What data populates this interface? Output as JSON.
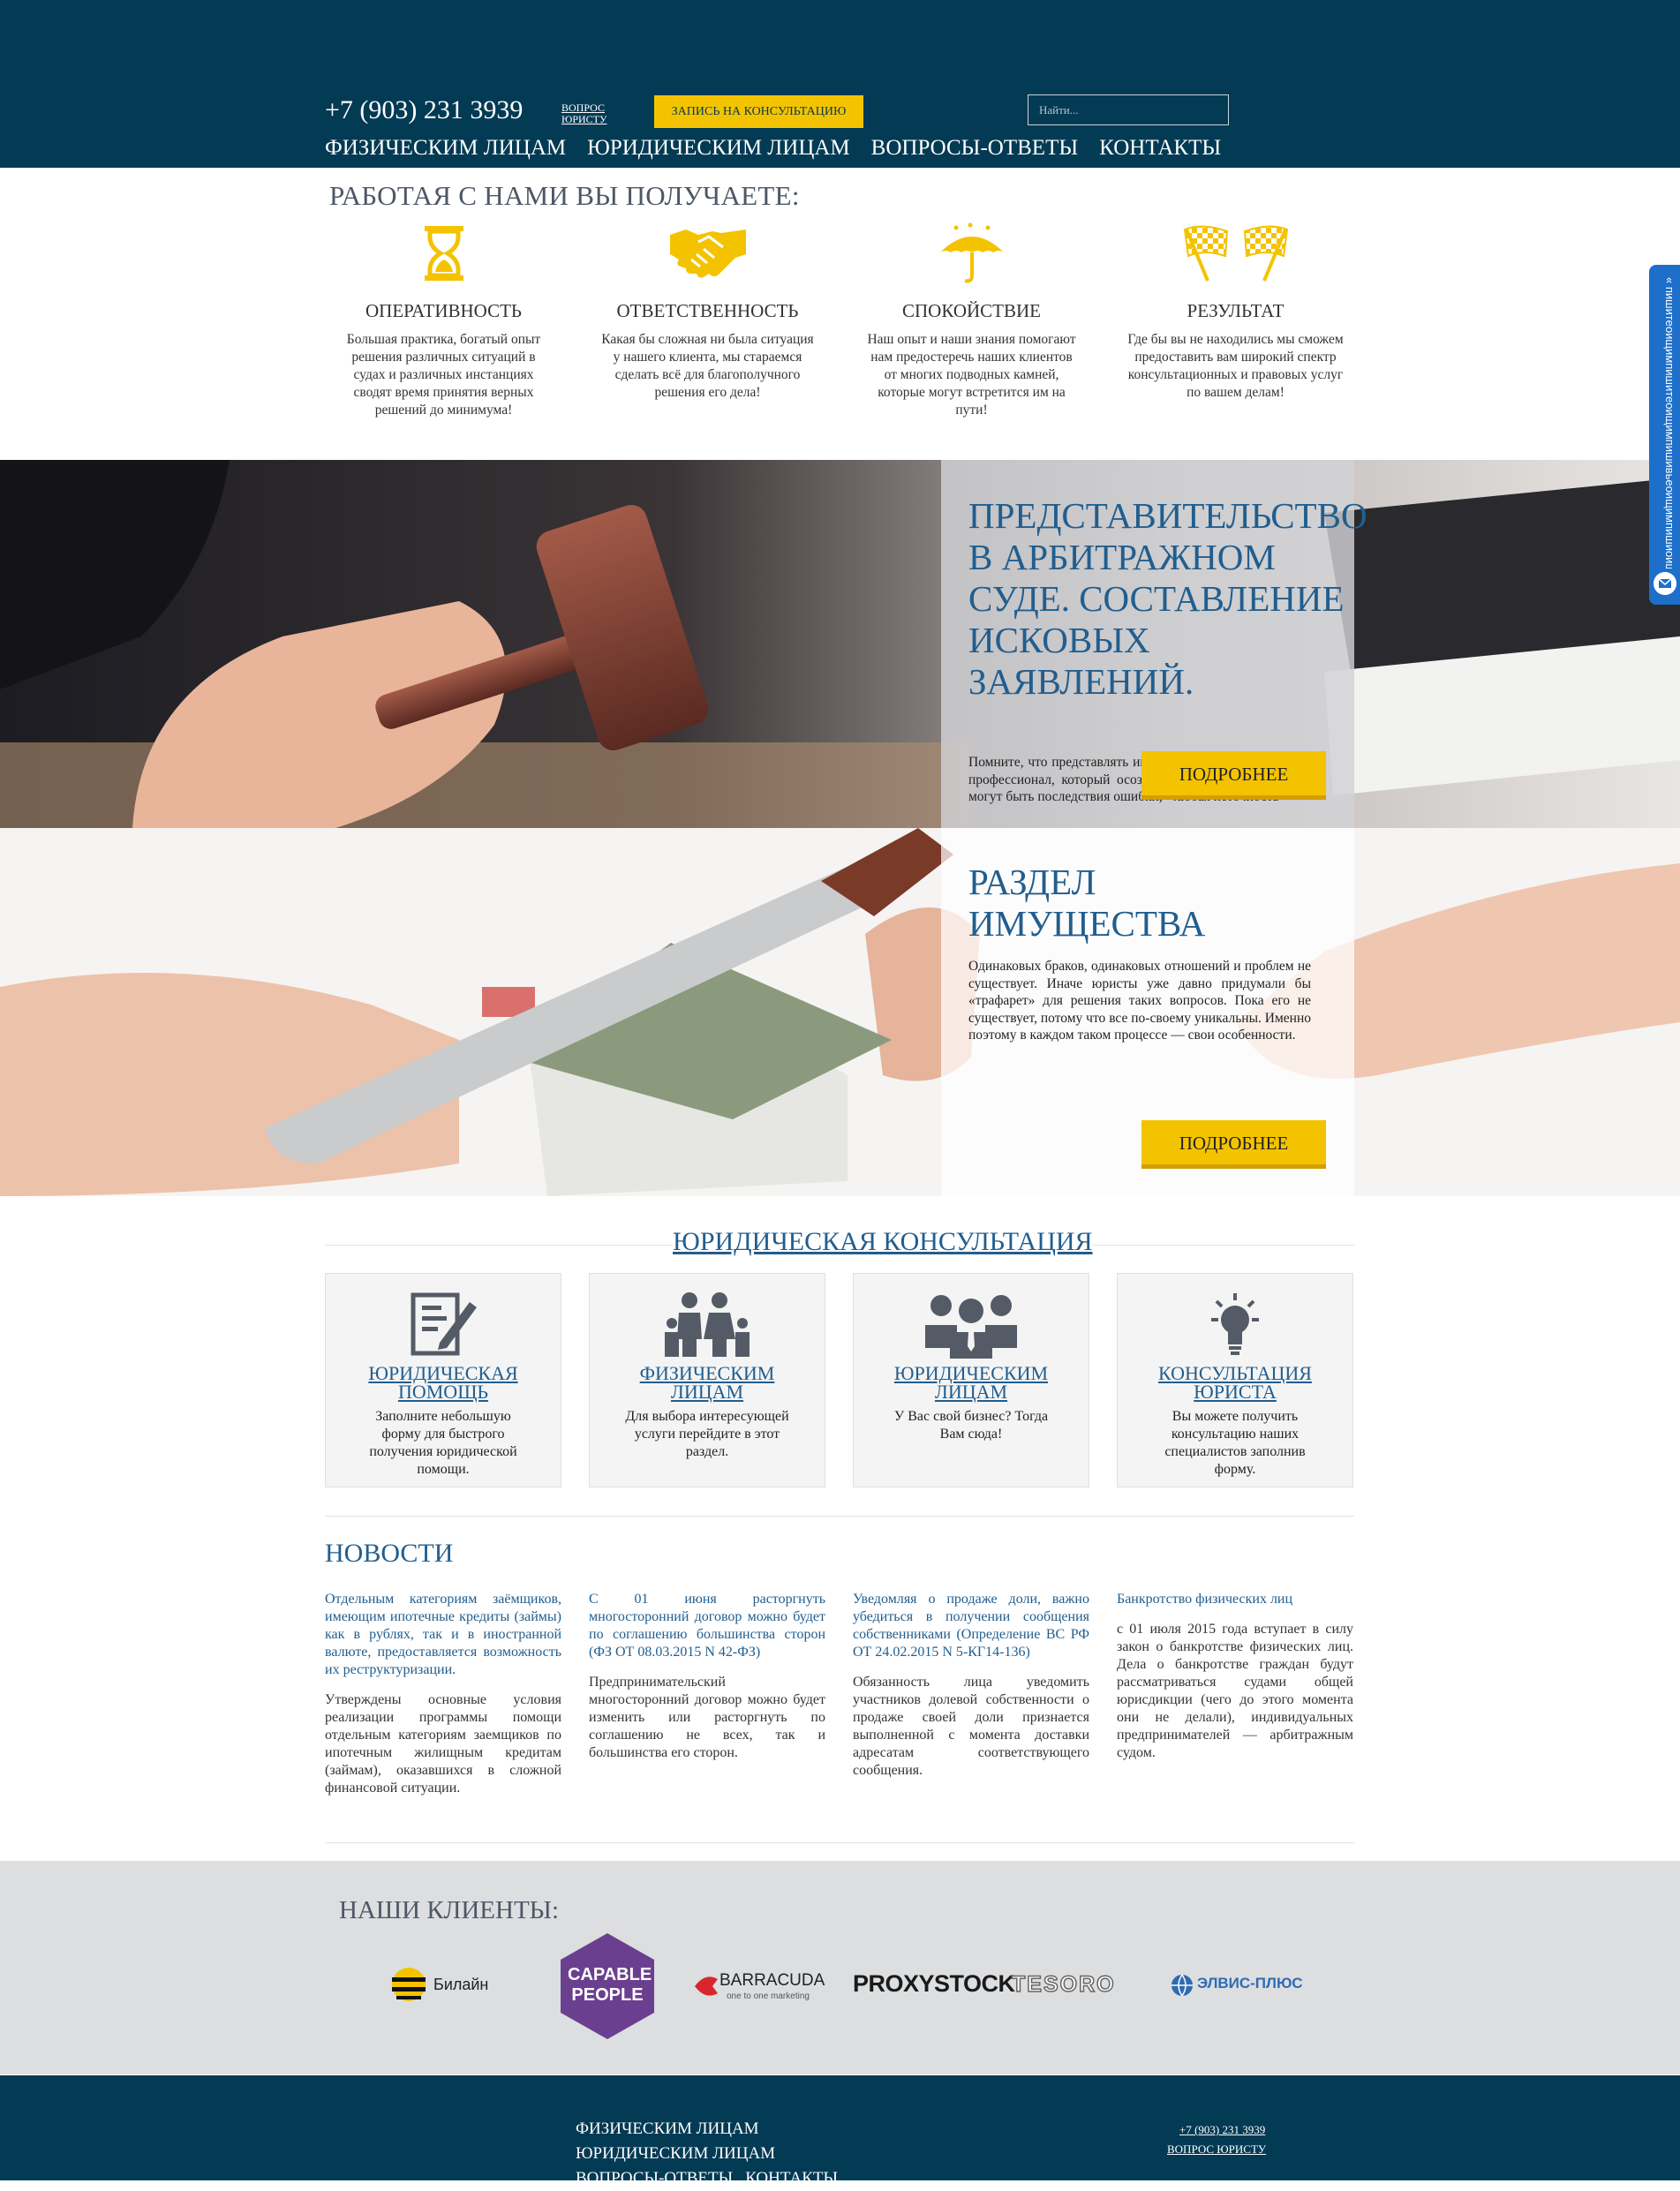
{
  "header": {
    "phone": "+7 (903) 231 3939",
    "ask_lawyer": "ВОПРОС ЮРИСТУ",
    "consult_button": "ЗАПИСЬ НА КОНСУЛЬТАЦИЮ",
    "search_placeholder": "Найти...",
    "nav": [
      "ФИЗИЧЕСКИМ ЛИЦАМ",
      "ЮРИДИЧЕСКИМ ЛИЦАМ",
      "ВОПРОСЫ-ОТВЕТЫ",
      "КОНТАКТЫ"
    ]
  },
  "benefits": {
    "title": "РАБОТАЯ С НАМИ ВЫ ПОЛУЧАЕТЕ:",
    "items": [
      {
        "icon": "hourglass-icon",
        "title": "ОПЕРАТИВНОСТЬ",
        "text": "Большая практика, богатый опыт решения различных ситуаций в судах и различных инстанциях сводят время принятия верных решений до минимума!"
      },
      {
        "icon": "handshake-icon",
        "title": "ОТВЕТСТВЕННОСТЬ",
        "text": "Какая бы сложная ни была ситуация у нашего клиента, мы стараемся сделать всё для благополучного решения его дела!"
      },
      {
        "icon": "umbrella-icon",
        "title": "СПОКОЙСТВИЕ",
        "text": "Наш опыт и наши знания помогают нам предостеречь наших клиентов от многих подводных камней, которые могут встретится им на пути!"
      },
      {
        "icon": "checkered-flags-icon",
        "title": "РЕЗУЛЬТАТ",
        "text": "Где бы вы не находились мы сможем предоставить вам широкий спектр консультационных и правовых услуг по вашем делам!"
      }
    ]
  },
  "banners": [
    {
      "title": "ПРЕДСТАВИТЕЛЬСТВО В АРБИТРАЖНОМ СУДЕ. СОСТАВЛЕНИЕ ИСКОВЫХ ЗАЯВЛЕНИЙ.",
      "text": "Помните, что представлять интересы в суде может только профессионал, который осознает, насколько серьезными могут быть последствия ошибки, - любая неточность",
      "button": "ПОДРОБНЕЕ"
    },
    {
      "title": "РАЗДЕЛ ИМУЩЕСТВА",
      "text": "Одинаковых браков, одинаковых отношений и проблем не существует. Иначе юристы уже давно придумали бы «трафарет» для решения таких вопросов. Пока его не существует, потому что все по-своему уникальны. Именно поэтому в каждом таком процессе — свои особенности.",
      "button": "ПОДРОБНЕЕ"
    }
  ],
  "consultation": {
    "title": "ЮРИДИЧЕСКАЯ КОНСУЛЬТАЦИЯ",
    "cards": [
      {
        "icon": "document-pen-icon",
        "title": "ЮРИДИЧЕСКАЯ ПОМОЩЬ",
        "text": "Заполните небольшую форму для быстрого получения юридической помощи."
      },
      {
        "icon": "family-icon",
        "title": "ФИЗИЧЕСКИМ ЛИЦАМ",
        "text": "Для выбора интересующей услуги перейдите в этот раздел."
      },
      {
        "icon": "business-team-icon",
        "title": "ЮРИДИЧЕСКИМ ЛИЦАМ",
        "text": "У Вас свой бизнес? Тогда Вам сюда!"
      },
      {
        "icon": "lightbulb-icon",
        "title": "КОНСУЛЬТАЦИЯ ЮРИСТА",
        "text": "Вы можете получить консультацию наших специалистов заполнив форму."
      }
    ]
  },
  "news": {
    "title": "НОВОСТИ",
    "items": [
      {
        "headline": "Отдельным категориям заёмщиков, имеющим ипотечные кредиты (займы) как в рублях, так и в иностранной валюте, предоставляется возможность их реструктуризации.",
        "body": "Утверждены основные условия реализации программы помощи отдельным категориям заемщиков по ипотечным жилищным кредитам (займам), оказавшихся в сложной финансовой ситуации."
      },
      {
        "headline": "С 01 июня расторгнуть многосторонний договор можно будет по соглашению большинства сторон (ФЗ ОТ 08.03.2015 N 42-ФЗ)",
        "body": "Предпринимательский многосторонний договор можно будет изменить или расторгнуть по соглашению не всех, так и большинства его сторон."
      },
      {
        "headline": "Уведомляя о продаже доли, важно убедиться в получении сообщения собственниками (Определение ВС РФ ОТ 24.02.2015 N 5-КГ14-136)",
        "body": "Обязанность лица уведомить участников долевой собственности о продаже своей доли признается выполненной с момента доставки адресатам соответствующего сообщения."
      },
      {
        "headline": "Банкротство физических лиц",
        "body": "с 01 июля 2015 года вступает в силу закон о банкротстве физических лиц. Дела о банкротстве граждан будут рассматриваться судами общей юрисдикции (чего до этого момента они не делали), индивидуальных предпринимателей — арбитражным судом."
      }
    ]
  },
  "clients": {
    "title": "НАШИ КЛИЕНТЫ:",
    "logos": [
      {
        "name": "Билайн",
        "icon": "beeline-logo"
      },
      {
        "name": "CAPABLE PEOPLE",
        "icon": "capable-people-logo"
      },
      {
        "name": "BARRACUDA",
        "tagline": "one to one marketing",
        "icon": "barracuda-logo"
      },
      {
        "name": "PROXYSTOCK",
        "icon": "proxystock-logo"
      },
      {
        "name": "TESORO",
        "icon": "tesoro-logo"
      },
      {
        "name": "ЭЛВИС-ПЛЮС",
        "icon": "elvis-plus-logo"
      }
    ]
  },
  "footer": {
    "nav": [
      "ФИЗИЧЕСКИМ ЛИЦАМ",
      "ЮРИДИЧЕСКИМ ЛИЦАМ",
      "ВОПРОСЫ-ОТВЕТЫ",
      "КОНТАКТЫ"
    ],
    "phone": "+7 (903) 231 3939",
    "ask_lawyer": "ВОПРОС ЮРИСТУ"
  },
  "side_tab": {
    "text": "« пишитеоищимпишитеоищимпишивьеоищимпишиоищим",
    "icon": "envelope-icon"
  },
  "colors": {
    "header_bg": "#033a54",
    "accent_yellow": "#f4c300",
    "link_blue": "#215e8f",
    "clients_bg": "#dcdee0",
    "side_tab_blue": "#1e6fc9"
  }
}
